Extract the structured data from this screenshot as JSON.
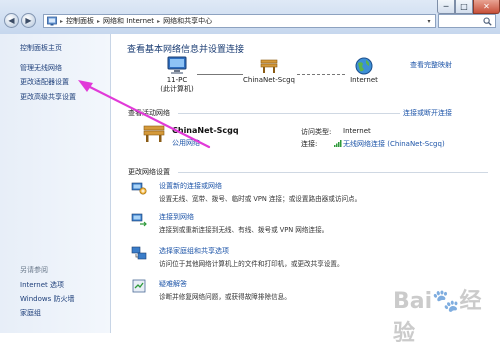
{
  "window": {
    "minimize_glyph": "─",
    "maximize_glyph": "□",
    "close_glyph": "✕"
  },
  "addressbar": {
    "segments": [
      "控制面板",
      "网络和 Internet",
      "网络和共享中心"
    ]
  },
  "left_pane": {
    "items": [
      "控制面板主页",
      "管理无线网络",
      "更改适配器设置",
      "更改高级共享设置"
    ],
    "see_also_title": "另请参阅",
    "see_also_items": [
      "Internet 选项",
      "Windows 防火墙",
      "家庭组"
    ]
  },
  "main": {
    "title": "查看基本网络信息并设置连接",
    "view_full_map": "查看完整映射",
    "nodes": [
      {
        "label": "11-PC",
        "sublabel": "(此计算机)"
      },
      {
        "label": "ChinaNet-Scgq",
        "sublabel": ""
      },
      {
        "label": "Internet",
        "sublabel": ""
      }
    ],
    "active_section": "查看活动网络",
    "connect_disconnect": "连接或断开连接",
    "active_network": {
      "name": "ChinaNet-Scgq",
      "type": "公用网络",
      "access_type_label": "访问类型:",
      "access_type_value": "Internet",
      "connections_label": "连接:",
      "connections_value": "无线网络连接 (ChinaNet-Scgq)"
    },
    "change_section": "更改网络设置",
    "tasks": [
      {
        "title": "设置新的连接或网络",
        "desc": "设置无线、宽带、拨号、临时或 VPN 连接；或设置路由器或访问点。",
        "icon": "new-connection-icon"
      },
      {
        "title": "连接到网络",
        "desc": "连接到或重新连接到无线、有线、拨号或 VPN 网络连接。",
        "icon": "connect-network-icon"
      },
      {
        "title": "选择家庭组和共享选项",
        "desc": "访问位于其他网络计算机上的文件和打印机，或更改共享设置。",
        "icon": "homegroup-icon"
      },
      {
        "title": "疑难解答",
        "desc": "诊断并修复网络问题，或获得故障排除信息。",
        "icon": "troubleshoot-icon"
      }
    ]
  },
  "colors": {
    "link": "#1e55a8",
    "annotation": "#e13ad8"
  }
}
